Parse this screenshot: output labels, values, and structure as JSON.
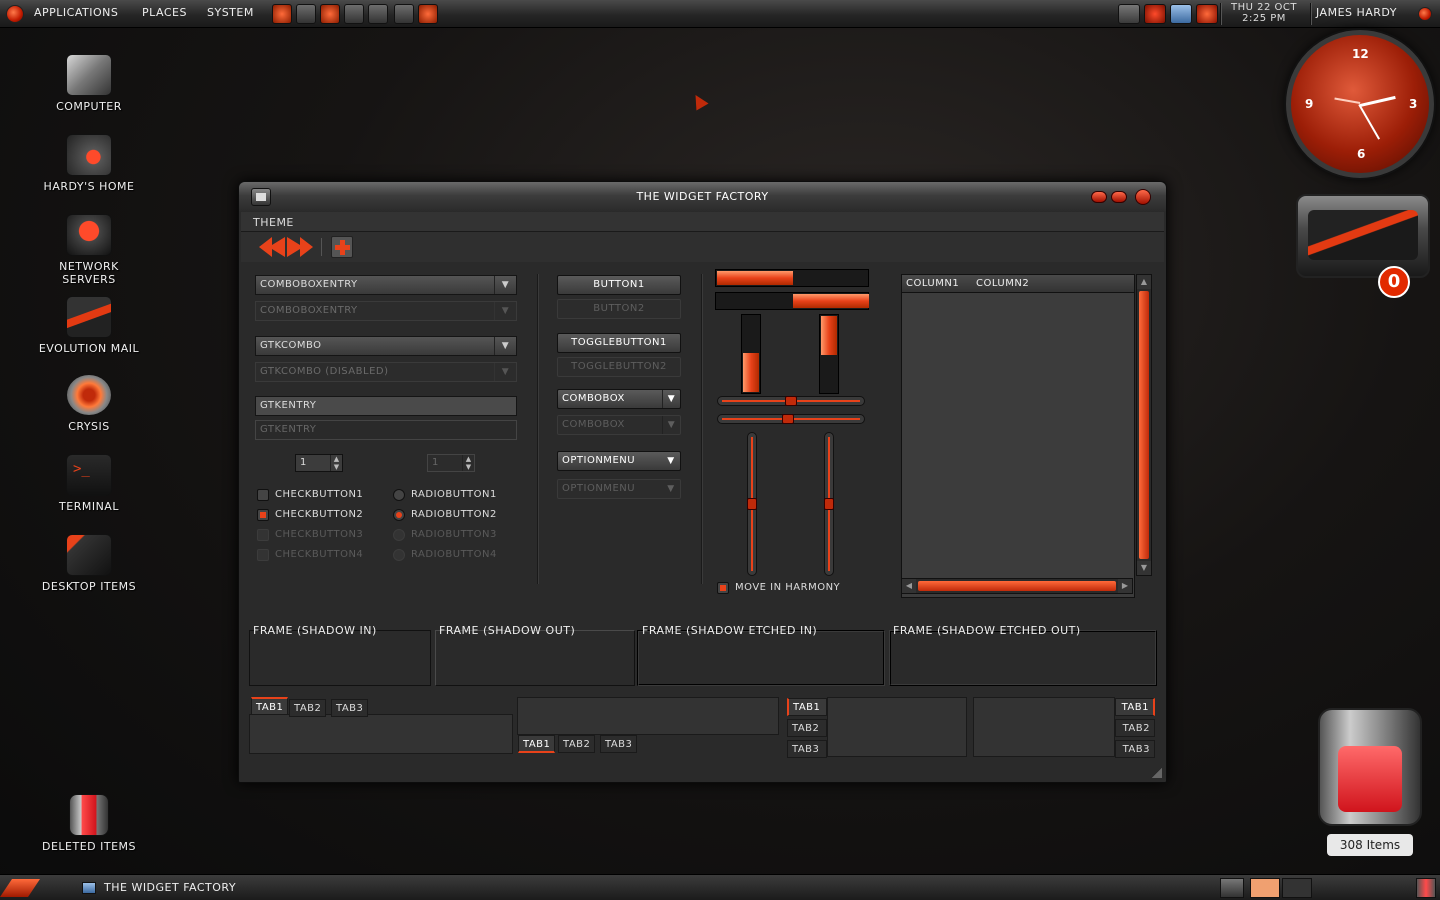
{
  "top_panel": {
    "menus": [
      "Applications",
      "Places",
      "System"
    ],
    "clock": {
      "line1": "Thu 22 Oct",
      "line2": "2:25 PM"
    },
    "user": "James Hardy"
  },
  "desktop_icons": [
    {
      "label": "Computer",
      "icon": "computer-icon"
    },
    {
      "label": "Hardy's Home",
      "icon": "home-folder-icon"
    },
    {
      "label": "Network Servers",
      "icon": "network-icon"
    },
    {
      "label": "Evolution Mail",
      "icon": "mail-icon"
    },
    {
      "label": "Crysis",
      "icon": "game-disc-icon"
    },
    {
      "label": "Terminal",
      "icon": "terminal-icon"
    },
    {
      "label": "Desktop Items",
      "icon": "folder-icon"
    },
    {
      "label": "Deleted Items",
      "icon": "trash-icon"
    }
  ],
  "widgets": {
    "clock": {
      "n12": "12",
      "n3": "3",
      "n6": "6",
      "n9": "9"
    },
    "mail": {
      "count": "0"
    },
    "trash": {
      "count": "308 Items"
    }
  },
  "window": {
    "title": "The Widget Factory",
    "menu": {
      "theme": "Theme"
    },
    "left_column": {
      "comboboxentry": "comboboxentry",
      "comboboxentry_disabled": "comboboxentry",
      "gtkcombo": "gtkcombo",
      "gtkcombo_disabled": "gtkcombo (disabled)",
      "gtkentry": "gtkentry",
      "gtkentry_disabled": "gtkentry",
      "spin1": "1",
      "spin2": "1",
      "checks": [
        "checkbutton1",
        "checkbutton2",
        "checkbutton3",
        "checkbutton4"
      ],
      "radios": [
        "radiobutton1",
        "radiobutton2",
        "radiobutton3",
        "radiobutton4"
      ]
    },
    "mid_column": {
      "button1": "button1",
      "button2": "button2",
      "toggle1": "togglebutton1",
      "toggle2": "togglebutton2",
      "combobox1": "combobox",
      "combobox2": "combobox",
      "option1": "optionmenu",
      "option2": "optionmenu"
    },
    "progress": {
      "h1": 0.5,
      "h2": 0.5,
      "v1": 0.5,
      "v2": 0.5,
      "hscale1": 0.5,
      "hscale2": 0.48,
      "vscale1": 0.5,
      "vscale2": 0.5,
      "harmony_label": "move in harmony"
    },
    "tree": {
      "columns": [
        "column1",
        "column2"
      ]
    },
    "frames": [
      "Frame (shadow in)",
      "Frame (shadow out)",
      "Frame (shadow etched in)",
      "Frame (shadow etched out)"
    ],
    "tabs": [
      "tab1",
      "tab2",
      "tab3"
    ]
  },
  "taskbar": {
    "item": "The Widget Factory"
  },
  "colors": {
    "accent": "#e8421a",
    "panel": "#262626",
    "window": "#2a2a2a"
  }
}
